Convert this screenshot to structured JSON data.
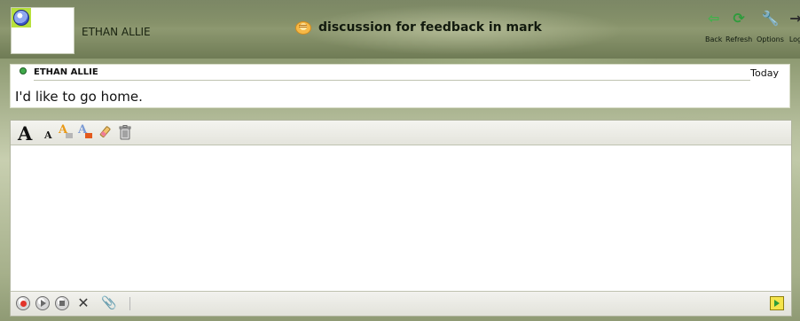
{
  "header": {
    "user_name": "ETHAN ALLIE",
    "title": "discussion for feedback in mark",
    "toolbar": [
      {
        "label": "Back",
        "icon": "back-arrow-icon"
      },
      {
        "label": "Refresh",
        "icon": "refresh-icon"
      },
      {
        "label": "Options",
        "icon": "wrench-icon"
      },
      {
        "label": "Log",
        "icon": "logout-icon"
      }
    ]
  },
  "message": {
    "author": "ETHAN ALLIE",
    "date": "Today",
    "text": "I'd like to go home."
  },
  "editor": {
    "format_tools": [
      {
        "name": "increase-font-size",
        "glyph": "A"
      },
      {
        "name": "decrease-font-size",
        "glyph": "A"
      },
      {
        "name": "highlight-color",
        "glyph": "A"
      },
      {
        "name": "font-color",
        "glyph": "A"
      },
      {
        "name": "eraser"
      },
      {
        "name": "trash"
      }
    ],
    "input_value": "",
    "media_tools": [
      {
        "name": "record"
      },
      {
        "name": "play"
      },
      {
        "name": "stop"
      },
      {
        "name": "cancel",
        "glyph": "✕"
      },
      {
        "name": "attach",
        "glyph": "📎"
      }
    ],
    "send": {
      "name": "send"
    }
  }
}
